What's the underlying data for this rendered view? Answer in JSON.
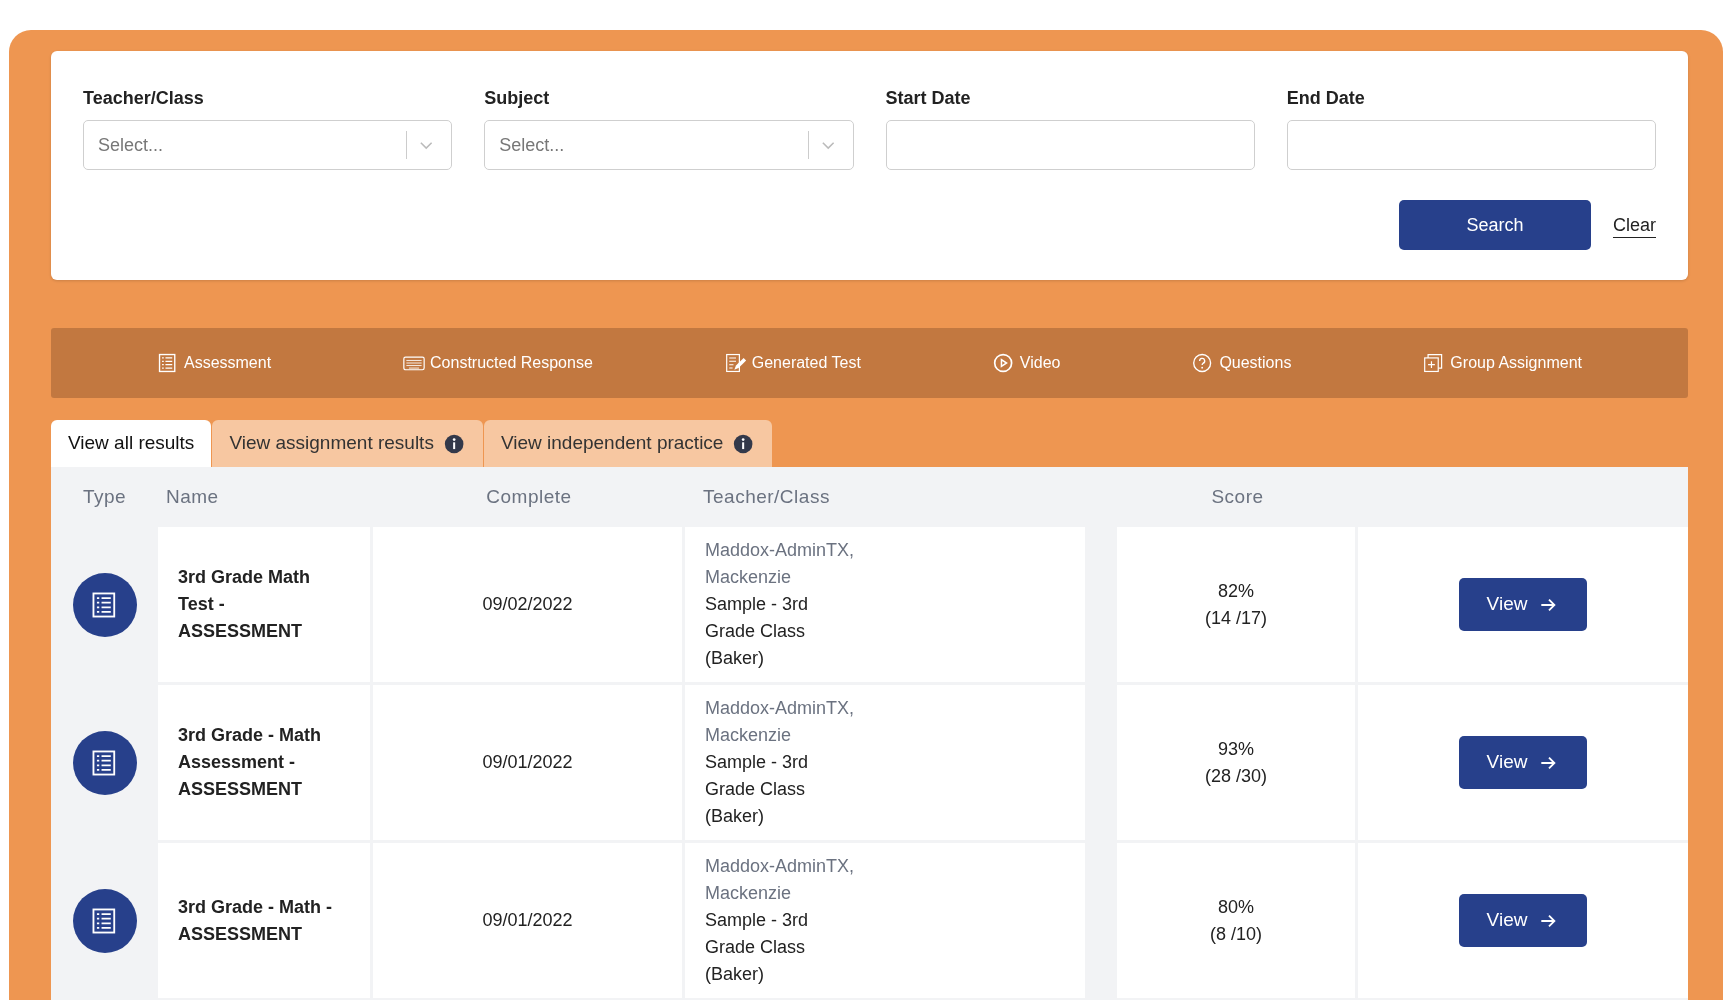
{
  "filters": [
    {
      "label": "Teacher/Class",
      "kind": "select",
      "placeholder": "Select..."
    },
    {
      "label": "Subject",
      "kind": "select",
      "placeholder": "Select..."
    },
    {
      "label": "Start Date",
      "kind": "text"
    },
    {
      "label": "End Date",
      "kind": "text"
    }
  ],
  "search_button": "Search",
  "clear_link": "Clear",
  "categories": [
    {
      "label": "Assessment",
      "kind": "list"
    },
    {
      "label": "Constructed Response",
      "kind": "keyboard"
    },
    {
      "label": "Generated Test",
      "kind": "pencil"
    },
    {
      "label": "Video",
      "kind": "play"
    },
    {
      "label": "Questions",
      "kind": "question"
    },
    {
      "label": "Group Assignment",
      "kind": "group"
    }
  ],
  "tabs": [
    {
      "label": "View all results",
      "selected": true,
      "info": false
    },
    {
      "label": "View assignment results",
      "selected": false,
      "info": true
    },
    {
      "label": "View independent practice",
      "selected": false,
      "info": true
    }
  ],
  "table": {
    "columns": [
      "Type",
      "Name",
      "Complete",
      "Teacher/Class",
      "Score"
    ],
    "rows": [
      {
        "name": "3rd Grade Math Test - ASSESSMENT",
        "complete": "09/02/2022",
        "teacher": "Maddox-AdminTX, Mackenzie",
        "class": "Sample - 3rd Grade Class (Baker)",
        "percent": "82%",
        "fraction": "(14 /17)",
        "action": "View"
      },
      {
        "name": "3rd Grade - Math Assessment - ASSESSMENT",
        "complete": "09/01/2022",
        "teacher": "Maddox-AdminTX, Mackenzie",
        "class": "Sample - 3rd Grade Class (Baker)",
        "percent": "93%",
        "fraction": "(28 /30)",
        "action": "View"
      },
      {
        "name": "3rd Grade - Math - ASSESSMENT",
        "complete": "09/01/2022",
        "teacher": "Maddox-AdminTX, Mackenzie",
        "class": "Sample - 3rd Grade Class (Baker)",
        "percent": "80%",
        "fraction": "(8 /10)",
        "action": "View"
      }
    ]
  }
}
